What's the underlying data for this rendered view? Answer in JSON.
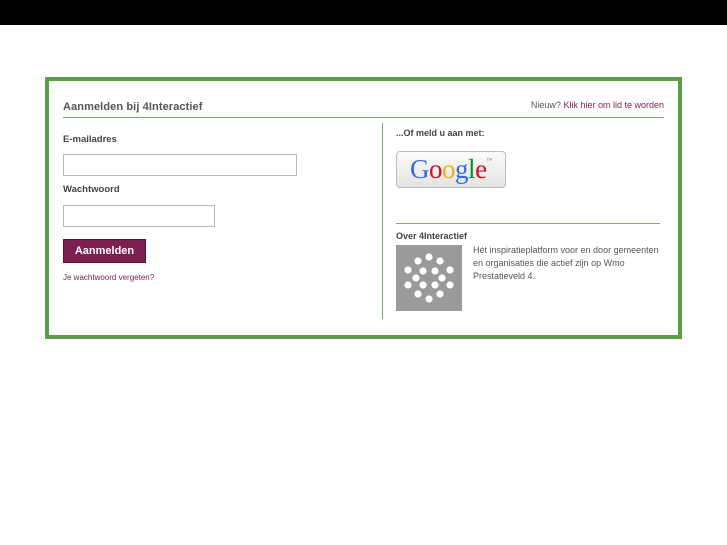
{
  "header": {
    "title": "Aanmelden bij 4Interactief",
    "new_prefix": "Nieuw?",
    "signup_link": "Klik hier om lid te worden"
  },
  "login": {
    "email_label": "E-mailadres",
    "email_value": "",
    "password_label": "Wachtwoord",
    "password_value": "",
    "submit_label": "Aanmelden",
    "forgot_link": "Je wachtwoord vergeten?"
  },
  "social": {
    "or_label": "...Of meld u aan met:",
    "google": {
      "letters": [
        "G",
        "o",
        "o",
        "g",
        "l",
        "e"
      ],
      "trademark": "™",
      "colors": [
        "#3369e8",
        "#d50f25",
        "#eeb211",
        "#3369e8",
        "#009925",
        "#d50f25"
      ]
    }
  },
  "about": {
    "title": "Over 4Interactief",
    "text": "Hét inspiratieplatform voor en door gemeenten en organisaties die actief zijn op Wmo Prestatieveld 4.",
    "logo_icon": "dots-circle-logo-icon"
  },
  "colors": {
    "border_green": "#5e9c48",
    "accent_purple": "#7a1f4f",
    "topbar": "#000000"
  }
}
